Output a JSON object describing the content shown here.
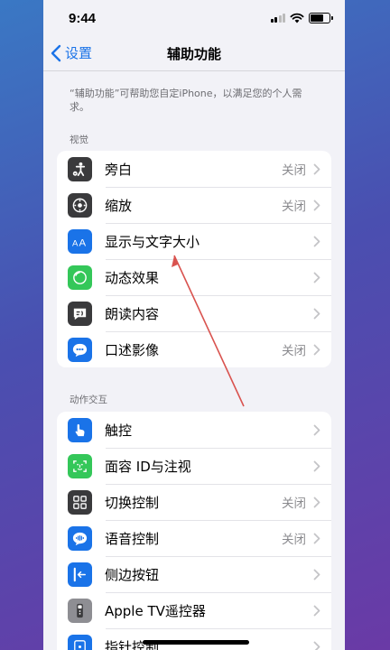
{
  "status": {
    "time": "9:44"
  },
  "nav": {
    "back_label": "设置",
    "title": "辅助功能"
  },
  "intro": "“辅助功能”可帮助您自定iPhone，以满足您的个人需求。",
  "sections": [
    {
      "header": "视觉",
      "rows": [
        {
          "label": "旁白",
          "value": "关闭",
          "icon": "voiceover-icon",
          "color": "#3a3a3c"
        },
        {
          "label": "缩放",
          "value": "关闭",
          "icon": "zoom-icon",
          "color": "#3a3a3c"
        },
        {
          "label": "显示与文字大小",
          "value": "",
          "icon": "display-text-size-icon",
          "color": "#1a73e8"
        },
        {
          "label": "动态效果",
          "value": "",
          "icon": "motion-icon",
          "color": "#34c759"
        },
        {
          "label": "朗读内容",
          "value": "",
          "icon": "spoken-content-icon",
          "color": "#3a3a3c"
        },
        {
          "label": "口述影像",
          "value": "关闭",
          "icon": "audio-descriptions-icon",
          "color": "#1a73e8"
        }
      ]
    },
    {
      "header": "动作交互",
      "rows": [
        {
          "label": "触控",
          "value": "",
          "icon": "touch-icon",
          "color": "#1a73e8"
        },
        {
          "label": "面容 ID与注视",
          "value": "",
          "icon": "face-id-icon",
          "color": "#34c759"
        },
        {
          "label": "切换控制",
          "value": "关闭",
          "icon": "switch-control-icon",
          "color": "#3a3a3c"
        },
        {
          "label": "语音控制",
          "value": "关闭",
          "icon": "voice-control-icon",
          "color": "#1a73e8"
        },
        {
          "label": "侧边按钮",
          "value": "",
          "icon": "side-button-icon",
          "color": "#1a73e8"
        },
        {
          "label": "Apple TV遥控器",
          "value": "",
          "icon": "apple-tv-remote-icon",
          "color": "#8e8e93"
        },
        {
          "label": "指针控制",
          "value": "",
          "icon": "pointer-control-icon",
          "color": "#1a73e8"
        }
      ]
    }
  ],
  "colors": {
    "accent": "#1a73e8",
    "background": "#f2f2f7",
    "annotation_arrow": "#d9534f"
  }
}
